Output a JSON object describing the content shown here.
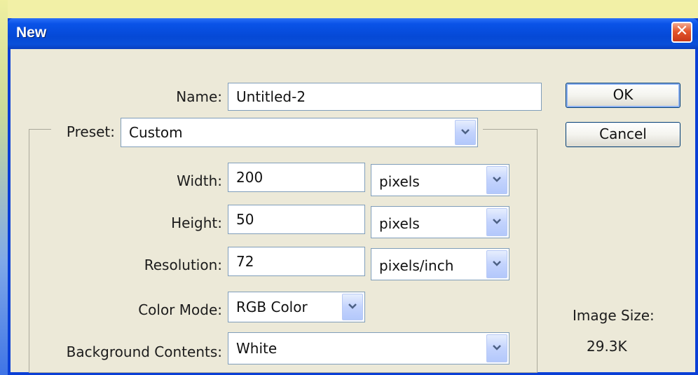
{
  "dialog": {
    "title": "New",
    "close_glyph": "✕"
  },
  "form": {
    "name_label": "Name:",
    "name_value": "Untitled-2",
    "preset_label": "Preset:",
    "preset_value": "Custom",
    "width_label": "Width:",
    "width_value": "200",
    "width_unit": "pixels",
    "height_label": "Height:",
    "height_value": "50",
    "height_unit": "pixels",
    "resolution_label": "Resolution:",
    "resolution_value": "72",
    "resolution_unit": "pixels/inch",
    "color_mode_label": "Color Mode:",
    "color_mode_value": "RGB Color",
    "background_label": "Background Contents:",
    "background_value": "White"
  },
  "buttons": {
    "ok": "OK",
    "cancel": "Cancel"
  },
  "image_size": {
    "label": "Image Size:",
    "value": "29.3K"
  }
}
